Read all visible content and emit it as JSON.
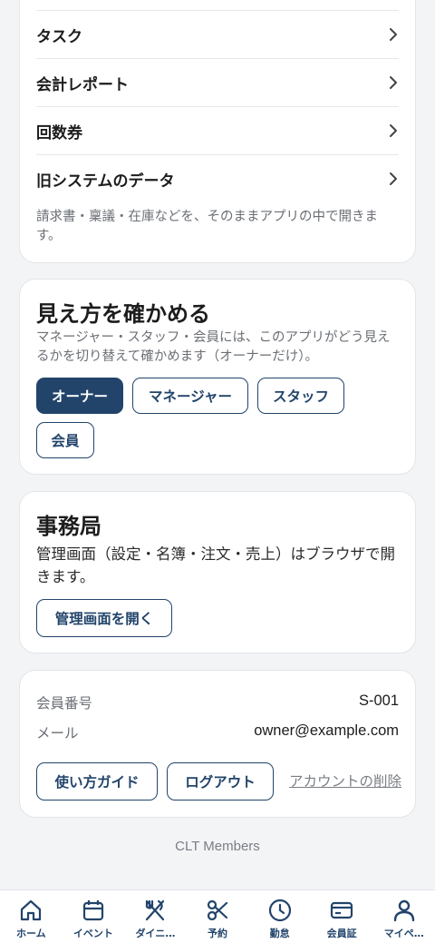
{
  "menu": {
    "items": [
      {
        "label": "タスク"
      },
      {
        "label": "会計レポート"
      },
      {
        "label": "回数券"
      },
      {
        "label": "旧システムのデータ"
      }
    ],
    "note": "請求書・稟議・在庫などを、そのままアプリの中で開きます。"
  },
  "view_switcher": {
    "title": "見え方を確かめる",
    "description": "マネージャー・スタッフ・会員には、このアプリがどう見えるかを切り替えて確かめます（オーナーだけ）。",
    "roles": [
      {
        "label": "オーナー",
        "selected": true
      },
      {
        "label": "マネージャー",
        "selected": false
      },
      {
        "label": "スタッフ",
        "selected": false
      },
      {
        "label": "会員",
        "selected": false
      }
    ]
  },
  "office": {
    "title": "事務局",
    "description": "管理画面（設定・名簿・注文・売上）はブラウザで開きます。",
    "open_button": "管理画面を開く"
  },
  "account": {
    "member_number_label": "会員番号",
    "member_number": "S-001",
    "email_label": "メール",
    "email": "owner@example.com",
    "guide_button": "使い方ガイド",
    "logout_button": "ログアウト",
    "delete_link": "アカウントの削除"
  },
  "footer": {
    "brand": "CLT Members"
  },
  "bottom_nav": {
    "items": [
      {
        "label": "ホーム",
        "icon": "home-icon"
      },
      {
        "label": "イベント",
        "icon": "calendar-icon"
      },
      {
        "label": "ダイニ…",
        "icon": "dining-icon"
      },
      {
        "label": "予約",
        "icon": "scissors-icon"
      },
      {
        "label": "勤怠",
        "icon": "clock-icon"
      },
      {
        "label": "会員証",
        "icon": "card-icon"
      },
      {
        "label": "マイペ…",
        "icon": "person-icon"
      }
    ]
  },
  "colors": {
    "primary": "#22446b",
    "muted": "#6b6f75",
    "background": "#f3f4f6"
  }
}
